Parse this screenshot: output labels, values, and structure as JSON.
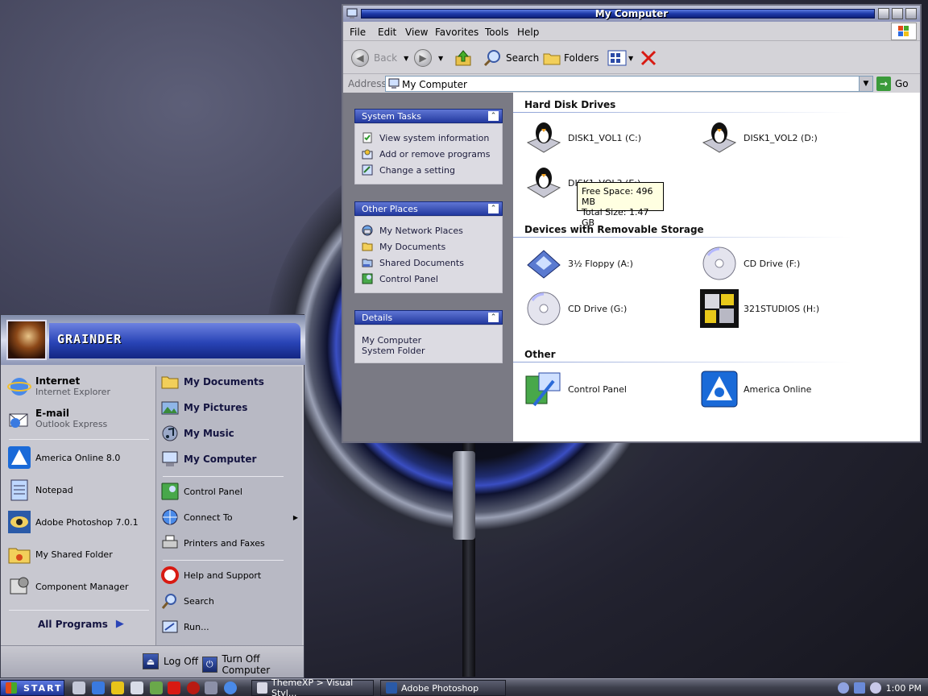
{
  "colors": {
    "accent": "#2944b6",
    "title_bar": "#1d3aa8",
    "tooltip": "#ffffe1",
    "desktop": "#2a2b3a"
  },
  "explorer": {
    "title": "My Computer",
    "menu": [
      "File",
      "Edit",
      "View",
      "Favorites",
      "Tools",
      "Help"
    ],
    "toolbar": {
      "back": "Back",
      "search": "Search",
      "folders": "Folders"
    },
    "address": {
      "label": "Address",
      "value": "My Computer",
      "go": "Go"
    },
    "system_tasks": {
      "title": "System Tasks",
      "items": [
        "View system information",
        "Add or remove programs",
        "Change a setting"
      ]
    },
    "other_places": {
      "title": "Other Places",
      "items": [
        "My Network Places",
        "My Documents",
        "Shared Documents",
        "Control Panel"
      ]
    },
    "details": {
      "title": "Details",
      "name": "My Computer",
      "type": "System Folder"
    },
    "groups": {
      "hard_disks": {
        "title": "Hard Disk Drives",
        "items": [
          "DISK1_VOL1 (C:)",
          "DISK1_VOL2 (D:)",
          "DISK1_VOL3 (E:)"
        ]
      },
      "removable": {
        "title": "Devices with Removable Storage",
        "items": [
          "3½ Floppy (A:)",
          "CD Drive (F:)",
          "CD Drive (G:)",
          "321STUDIOS (H:)"
        ]
      },
      "other": {
        "title": "Other",
        "items": [
          "Control Panel",
          "America Online"
        ]
      }
    },
    "tooltip": {
      "free": "Free Space: 496 MB",
      "total": "Total Size: 1.47 GB"
    }
  },
  "start_menu": {
    "user": "GRAINDER",
    "pinned": [
      {
        "title": "Internet",
        "subtitle": "Internet Explorer",
        "icon": "internet-explorer-icon"
      },
      {
        "title": "E-mail",
        "subtitle": "Outlook Express",
        "icon": "outlook-express-icon"
      }
    ],
    "recent": [
      "America Online 8.0",
      "Notepad",
      "Adobe Photoshop 7.0.1",
      "My Shared Folder",
      "Component Manager"
    ],
    "all_programs": "All Programs",
    "right": {
      "folders": [
        "My Documents",
        "My Pictures",
        "My Music",
        "My Computer"
      ],
      "settings": [
        "Control Panel",
        "Connect To",
        "Printers and Faxes"
      ],
      "help": [
        "Help and Support",
        "Search",
        "Run..."
      ]
    },
    "footer": {
      "log_off": "Log Off",
      "turn_off": "Turn Off Computer"
    }
  },
  "taskbar": {
    "start": "START",
    "tasks": [
      "ThemeXP > Visual Styl...",
      "Adobe Photoshop"
    ],
    "clock": "1:00 PM"
  }
}
